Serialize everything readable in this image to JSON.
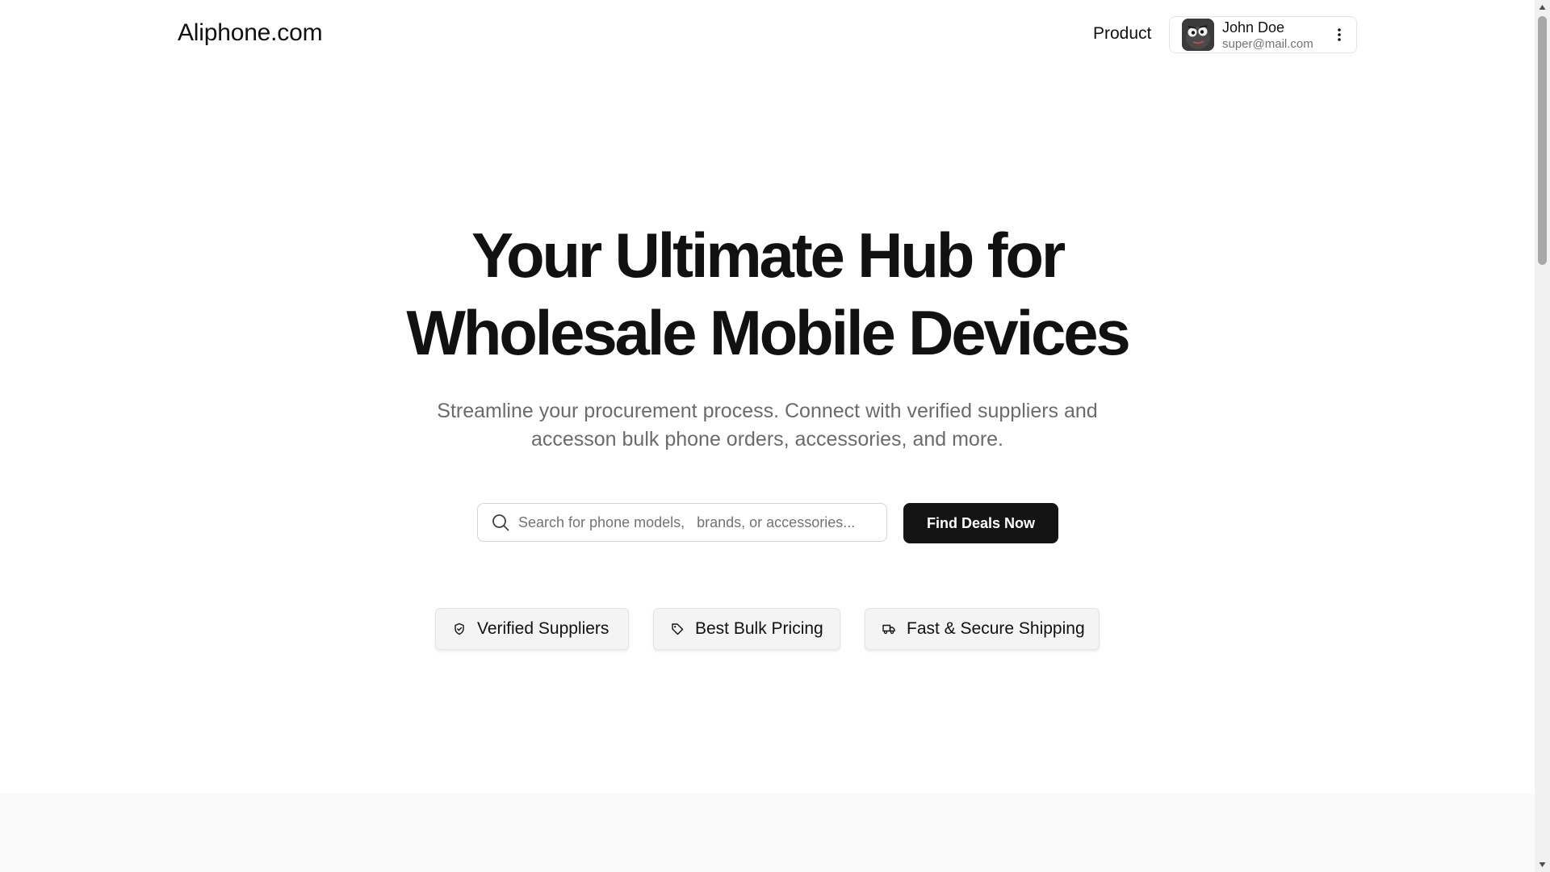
{
  "header": {
    "logo": "Aliphone.com",
    "nav_product": "Product",
    "user": {
      "name": "John Doe",
      "email": "super@mail.com"
    }
  },
  "hero": {
    "title_line1": "Your Ultimate Hub for",
    "title_line2": "Wholesale Mobile Devices",
    "subtitle_line1": "Streamline your procurement process. Connect with verified suppliers and",
    "subtitle_line2": "accesson bulk phone orders, accessories, and more."
  },
  "search": {
    "value": "",
    "placeholder": "Search for phone models,   brands, or accessories...",
    "button_label": "Find Deals Now"
  },
  "features": [
    {
      "label": "Verified Suppliers",
      "icon": "shield-check-icon"
    },
    {
      "label": "Best Bulk Pricing",
      "icon": "tag-icon"
    },
    {
      "label": "Fast & Secure Shipping",
      "icon": "truck-icon"
    }
  ],
  "colors": {
    "primary_button": "#141414",
    "text": "#111111",
    "muted_text": "#6b6b6b",
    "feature_bg": "#f4f4f5"
  }
}
